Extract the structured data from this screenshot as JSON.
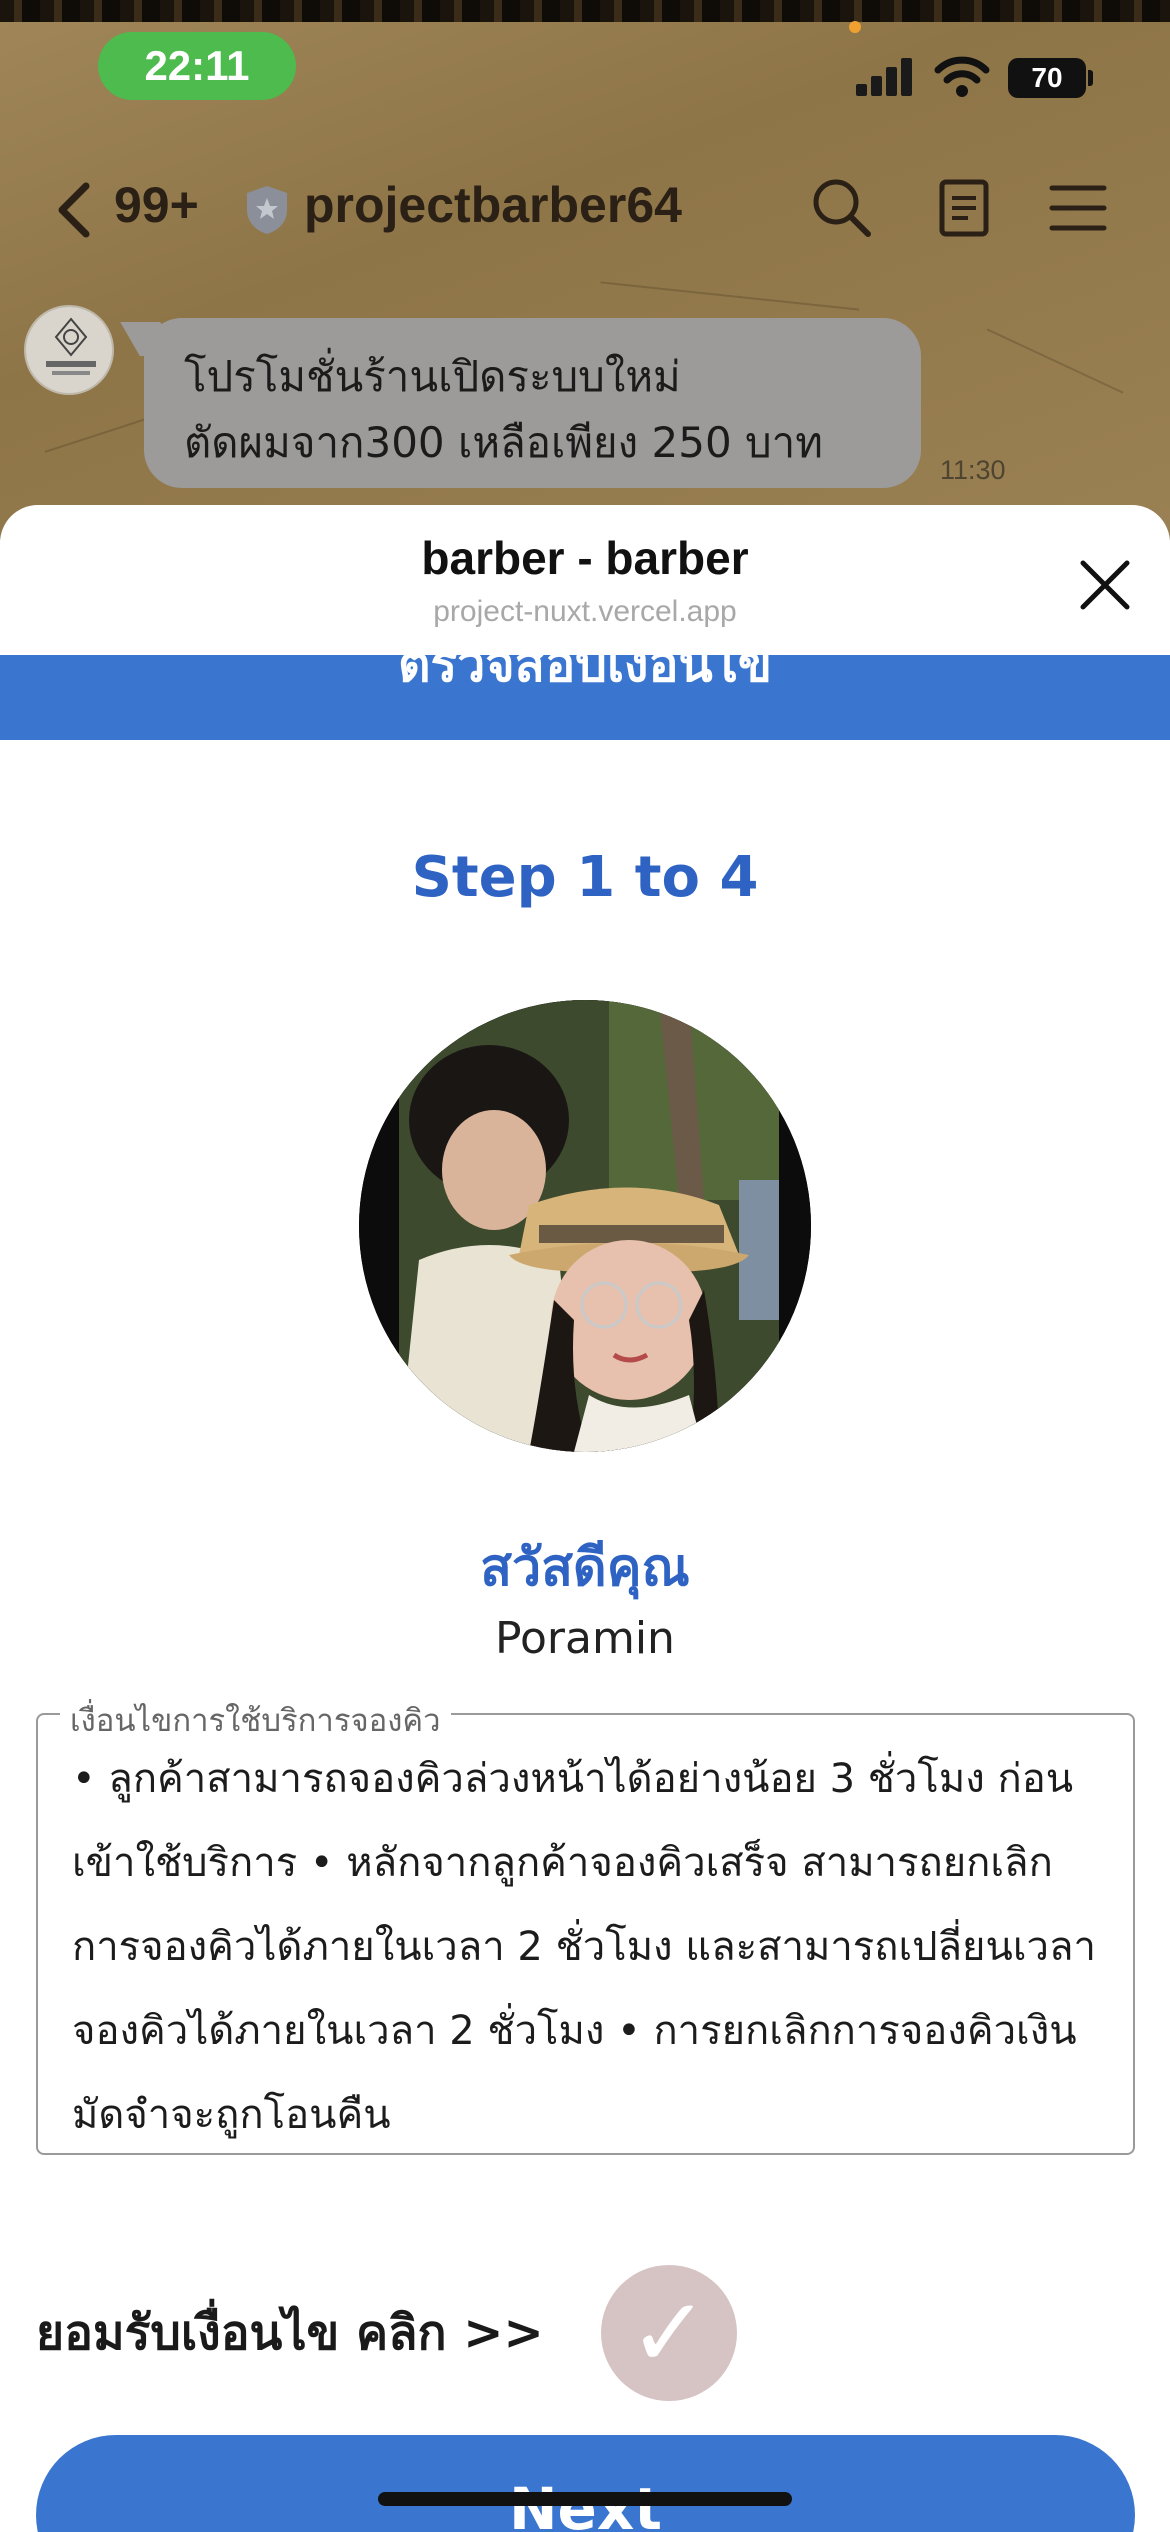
{
  "status_bar": {
    "time": "22:11",
    "battery": "70"
  },
  "chat_header": {
    "back_count": "99+",
    "title": "projectbarber64"
  },
  "message": {
    "lines": [
      "โปรโมชั่นร้านเปิดระบบใหม่",
      "ตัดผมจาก300 เหลือเพียง 250 บาท"
    ],
    "time": "11:30"
  },
  "sheet": {
    "title": "barber - barber",
    "url": "project-nuxt.vercel.app"
  },
  "page": {
    "banner_text": "ตรวจสอบเงื่อนไข",
    "step_title": "Step 1 to 4",
    "greeting": "สวัสดีคุณ",
    "username": "Poramin",
    "terms_legend": "เงื่อนไขการใช้บริการจองคิว",
    "terms_text": "• ลูกค้าสามารถจองคิวล่วงหน้าได้อย่างน้อย 3 ชั่วโมง ก่อนเข้าใช้บริการ • หลักจากลูกค้าจองคิวเสร็จ สามารถยกเลิกการจองคิวได้ภายในเวลา 2 ชั่วโมง และสามารถเปลี่ยนเวลาจองคิวได้ภายในเวลา 2 ชั่วโมง • การยกเลิกการจองคิวเงินมัดจำจะถูกโอนคืน",
    "accept_label": "ยอมรับเงื่อนไข คลิก >>",
    "accept_check": "✓",
    "next_label": "Next"
  },
  "colors": {
    "accent": "#3a76d0",
    "step_title": "#2f63c3",
    "check_bg": "#d6c4c4"
  }
}
